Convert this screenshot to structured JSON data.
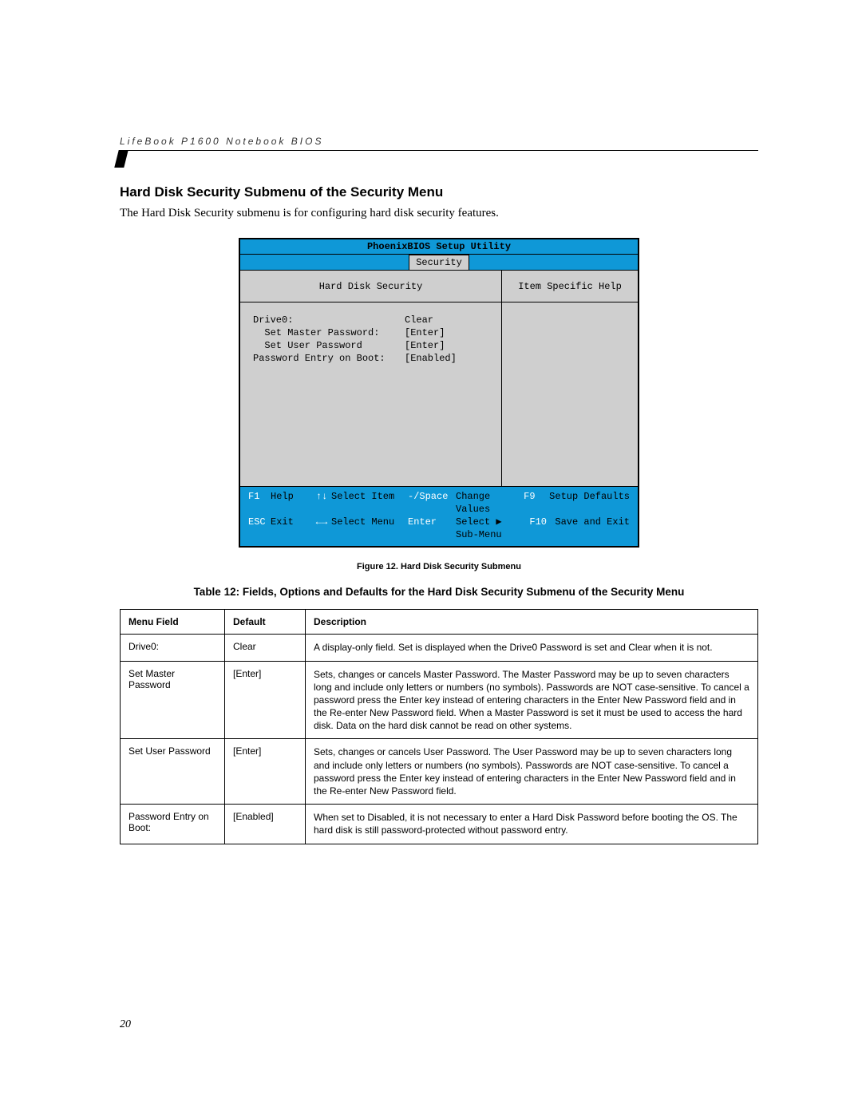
{
  "running_head": "LifeBook P1600 Notebook BIOS",
  "section_title": "Hard Disk Security Submenu of the Security Menu",
  "intro": "The Hard Disk Security submenu is for configuring hard disk security features.",
  "bios": {
    "title": "PhoenixBIOS Setup Utility",
    "tab": "Security",
    "left_heading": "Hard Disk Security",
    "right_heading": "Item Specific Help",
    "rows": [
      {
        "label": "Drive0:",
        "value": "Clear"
      },
      {
        "label": "  Set Master Password:",
        "value": "[Enter]"
      },
      {
        "label": "  Set User Password",
        "value": "[Enter]"
      },
      {
        "label": "",
        "value": ""
      },
      {
        "label": "Password Entry on Boot:",
        "value": "[Enabled]"
      }
    ],
    "footer": {
      "row1": {
        "k1": "F1",
        "l1": "Help",
        "arr": "↑↓",
        "a1": "Select Item",
        "k2": "-/Space",
        "a2": "Change Values",
        "k3": "F9",
        "a3": "Setup Defaults"
      },
      "row2": {
        "k1": "ESC",
        "l1": "Exit",
        "arr": "←→",
        "a1": "Select Menu",
        "k2": "Enter",
        "a2": "Select ▶ Sub-Menu",
        "k3": "F10",
        "a3": "Save and Exit"
      }
    }
  },
  "figure_caption": "Figure 12.  Hard Disk Security Submenu",
  "table_caption": "Table 12: Fields, Options and Defaults for the Hard Disk Security Submenu of the Security Menu",
  "table": {
    "headers": [
      "Menu Field",
      "Default",
      "Description"
    ],
    "rows": [
      {
        "field": "Drive0:",
        "default": "Clear",
        "desc": "A display-only field. Set is displayed when the Drive0 Password is set and Clear when it is not."
      },
      {
        "field": "Set Master Password",
        "default": "[Enter]",
        "desc": "Sets, changes or cancels Master Password. The Master Password may be up to seven characters long and include only letters or numbers (no symbols). Passwords are NOT case-sensitive. To cancel a password press the Enter key instead of entering characters in the Enter New Password field and in the Re-enter New Password field. When a Master Password is set it must be used to access the hard disk. Data on the hard disk cannot be read on other systems."
      },
      {
        "field": "Set User Password",
        "default": "[Enter]",
        "desc": "Sets, changes or cancels User Password. The User Password may be up to seven characters long and include only letters or numbers (no symbols). Passwords are NOT case-sensitive. To cancel a password press the Enter key instead of entering characters in the Enter New Password field and in the Re-enter New Password field."
      },
      {
        "field": "Password Entry on Boot:",
        "default": "[Enabled]",
        "desc": "When set to Disabled, it is not necessary to enter a Hard Disk Password before booting the OS. The hard disk is still password-protected without password entry."
      }
    ]
  },
  "page_number": "20"
}
